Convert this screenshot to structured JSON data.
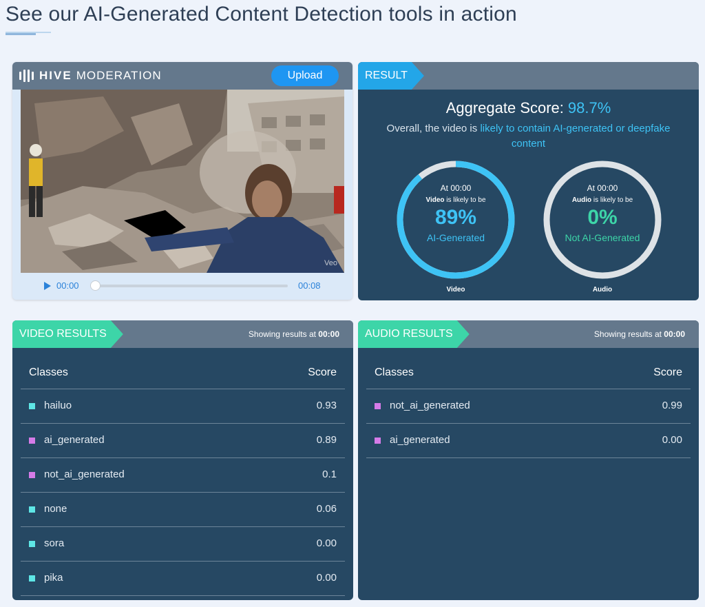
{
  "page": {
    "title": "See our AI-Generated Content Detection tools in action"
  },
  "player": {
    "logo_bold": "HIVE",
    "logo_light": "MODERATION",
    "upload_label": "Upload",
    "watermark": "Veo",
    "time_current": "00:00",
    "time_total": "00:08",
    "progress": 0
  },
  "result": {
    "tag": "RESULT",
    "aggregate_label": "Aggregate Score:",
    "aggregate_value": "98.7%",
    "summary_prefix": "Overall, the video is ",
    "summary_highlight": "likely to contain AI-generated or deepfake content",
    "gauges": [
      {
        "at": "At 00:00",
        "media": "Video",
        "likely": " is likely to be",
        "percent": "89%",
        "fraction": 0.89,
        "verdict": "AI-Generated",
        "caption": "Video",
        "color": "#3ec3f5"
      },
      {
        "at": "At 00:00",
        "media": "Audio",
        "likely": " is likely to be",
        "percent": "0%",
        "fraction": 0.0,
        "verdict": "Not AI-Generated",
        "caption": "Audio",
        "color": "#3dd5a8"
      }
    ]
  },
  "video_results": {
    "tag": "VIDEO RESULTS",
    "showing_prefix": "Showing results at ",
    "showing_time": "00:00",
    "col_classes": "Classes",
    "col_score": "Score",
    "rows": [
      {
        "cls": "hailuo",
        "score": "0.93",
        "color": "#5ee6e6"
      },
      {
        "cls": "ai_generated",
        "score": "0.89",
        "color": "#d57be8"
      },
      {
        "cls": "not_ai_generated",
        "score": "0.1",
        "color": "#d57be8"
      },
      {
        "cls": "none",
        "score": "0.06",
        "color": "#5ee6e6"
      },
      {
        "cls": "sora",
        "score": "0.00",
        "color": "#5ee6e6"
      },
      {
        "cls": "pika",
        "score": "0.00",
        "color": "#5ee6e6"
      }
    ]
  },
  "audio_results": {
    "tag": "AUDIO RESULTS",
    "showing_prefix": "Showing results at ",
    "showing_time": "00:00",
    "col_classes": "Classes",
    "col_score": "Score",
    "rows": [
      {
        "cls": "not_ai_generated",
        "score": "0.99",
        "color": "#d57be8"
      },
      {
        "cls": "ai_generated",
        "score": "0.00",
        "color": "#d57be8"
      }
    ]
  },
  "colors": {
    "accent_blue": "#3ec3f5",
    "accent_green": "#3dd5a8",
    "panel": "#264863",
    "header": "#64788c"
  }
}
